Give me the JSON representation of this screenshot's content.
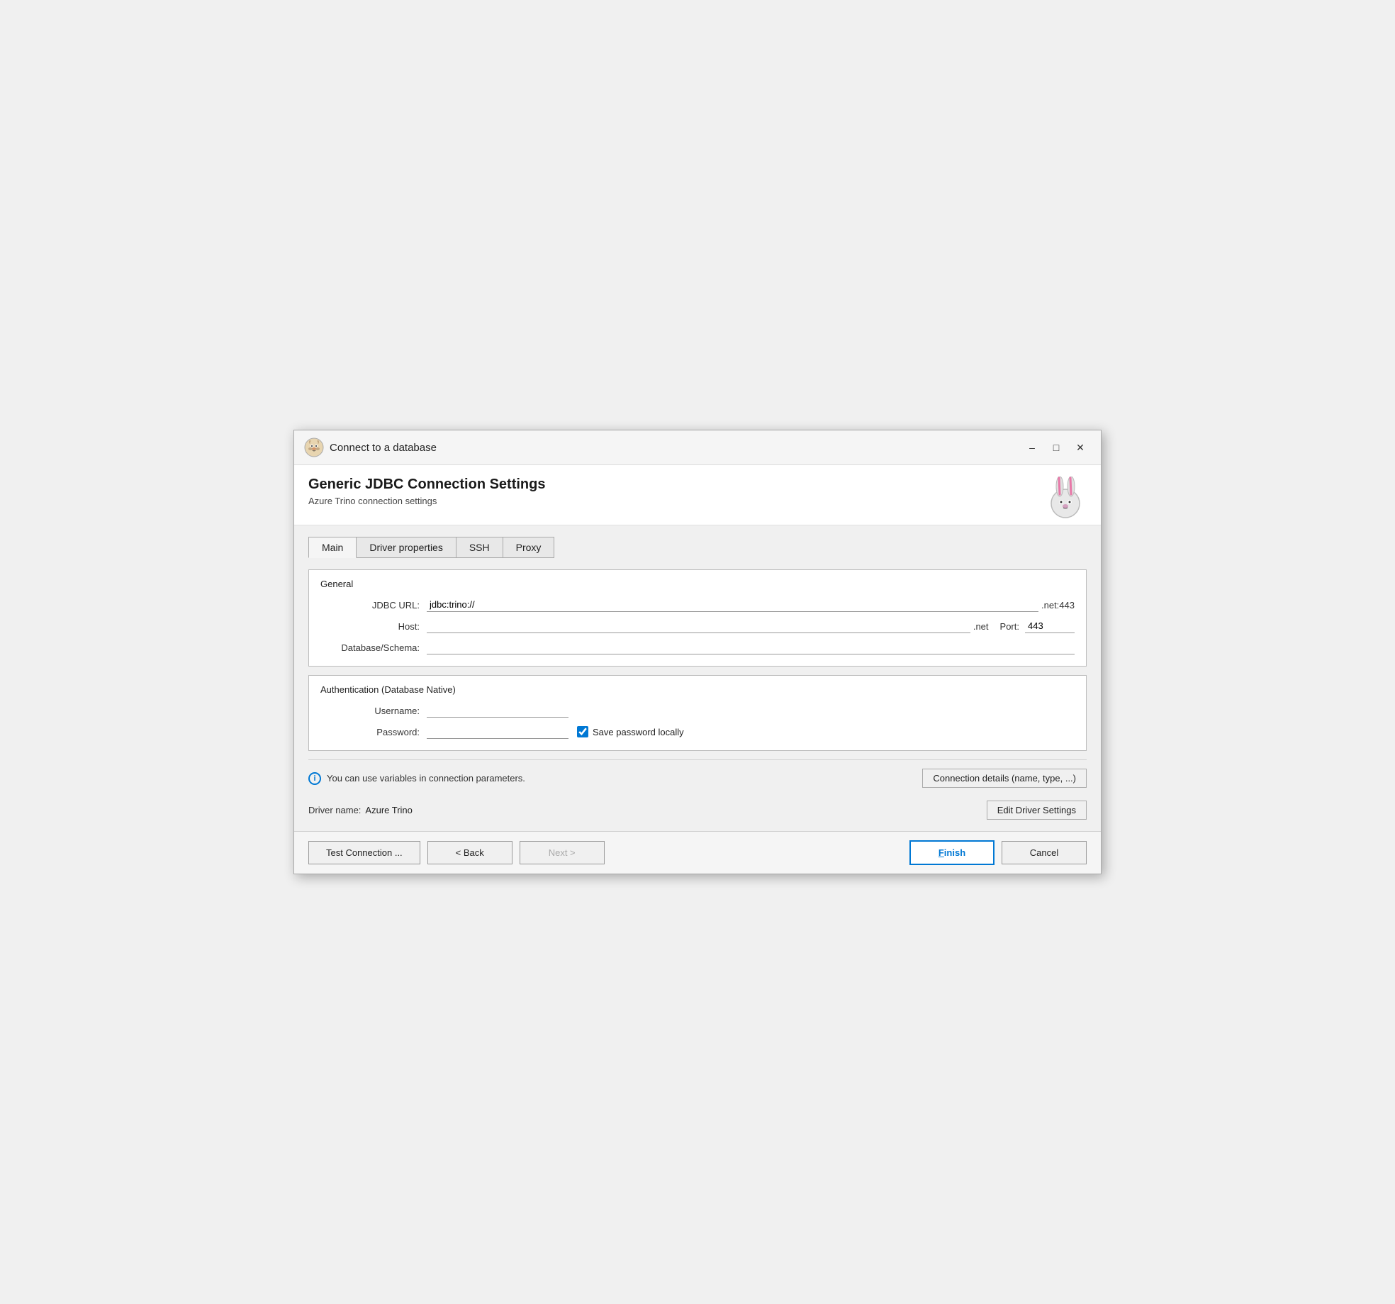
{
  "window": {
    "title": "Connect to a database",
    "minimize_label": "minimize",
    "maximize_label": "maximize",
    "close_label": "close"
  },
  "header": {
    "main_title": "Generic JDBC Connection Settings",
    "subtitle": "Azure Trino connection settings"
  },
  "tabs": [
    {
      "label": "Main",
      "active": true
    },
    {
      "label": "Driver properties",
      "active": false
    },
    {
      "label": "SSH",
      "active": false
    },
    {
      "label": "Proxy",
      "active": false
    }
  ],
  "general_section": {
    "title": "General",
    "jdbc_url_label": "JDBC URL:",
    "jdbc_url_value": "jdbc:trino://",
    "jdbc_url_suffix": ".net:443",
    "host_label": "Host:",
    "host_value": "",
    "host_suffix": ".net",
    "port_label": "Port:",
    "port_value": "443",
    "db_label": "Database/Schema:",
    "db_value": ""
  },
  "auth_section": {
    "title": "Authentication (Database Native)",
    "username_label": "Username:",
    "username_value": "",
    "password_label": "Password:",
    "password_value": "",
    "save_password_label": "Save password locally",
    "save_password_checked": true
  },
  "info": {
    "text": "You can use variables in connection parameters.",
    "connection_details_btn": "Connection details (name, type, ...)"
  },
  "driver": {
    "label": "Driver name:",
    "name": "Azure Trino",
    "edit_btn": "Edit Driver Settings"
  },
  "footer": {
    "test_connection_btn": "Test Connection ...",
    "back_btn": "< Back",
    "next_btn": "Next >",
    "finish_btn": "Finish",
    "cancel_btn": "Cancel"
  }
}
